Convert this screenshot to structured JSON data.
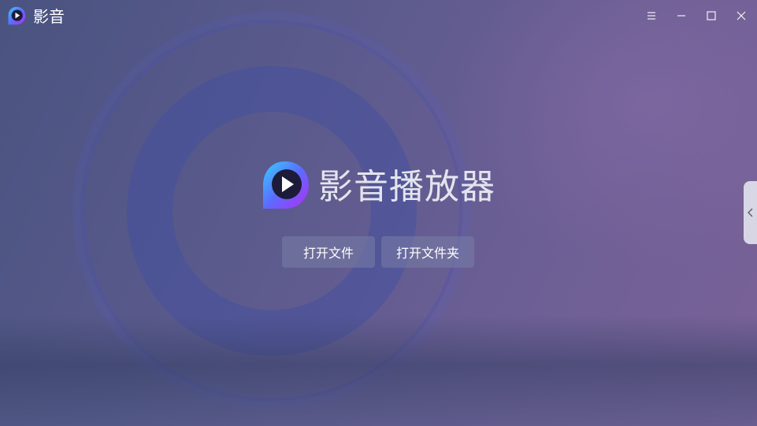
{
  "window": {
    "title": "影音"
  },
  "titlebar": {
    "menu_icon": "hamburger-menu-icon",
    "minimize_icon": "minimize-icon",
    "maximize_icon": "maximize-icon",
    "close_icon": "close-icon"
  },
  "main": {
    "app_name": "影音播放器",
    "open_file_label": "打开文件",
    "open_folder_label": "打开文件夹"
  },
  "drawer": {
    "toggle_icon": "chevron-left-icon"
  },
  "colors": {
    "logo_gradient_start": "#35d0ff",
    "logo_gradient_mid": "#5b6cff",
    "logo_gradient_end": "#b22df5",
    "logo_inner": "#1d1b3a"
  }
}
